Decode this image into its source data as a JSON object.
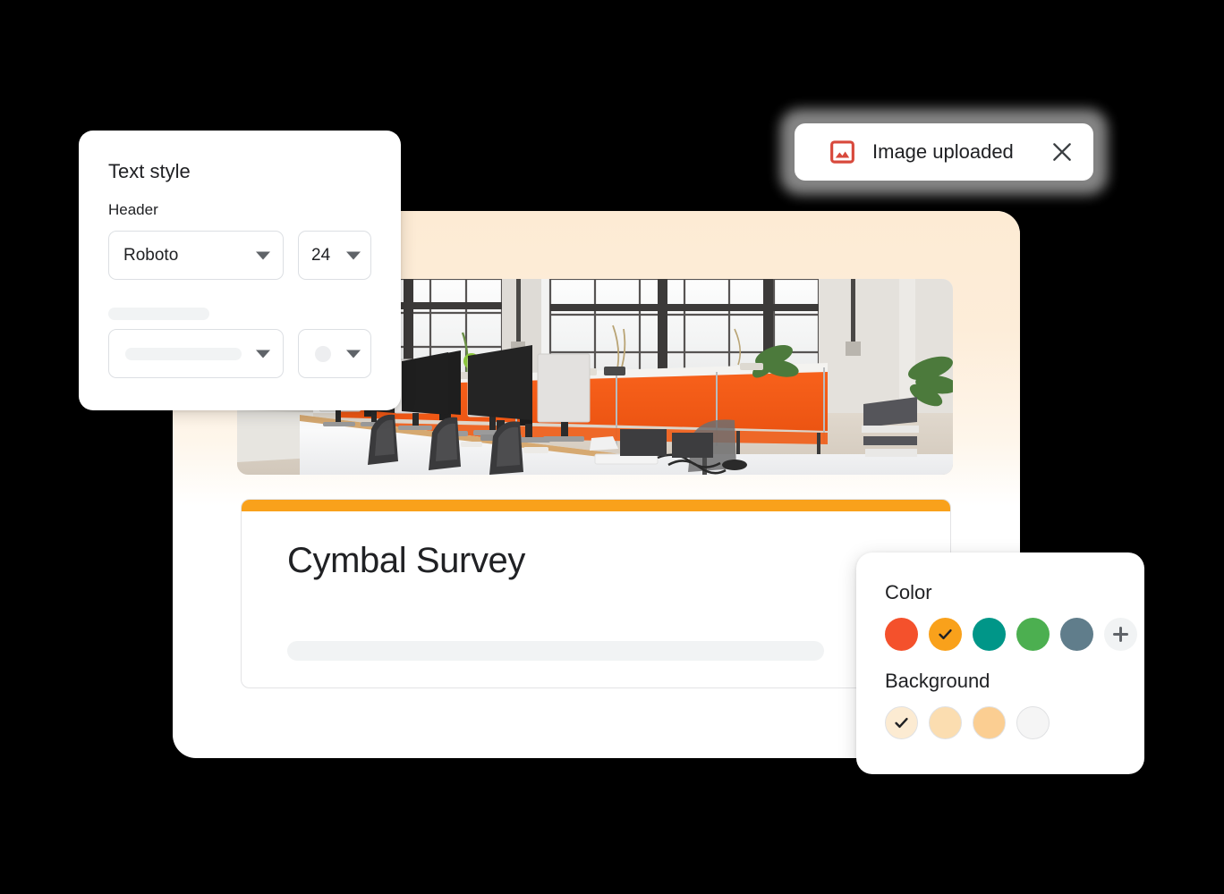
{
  "main_card": {
    "survey": {
      "title": "Cymbal Survey",
      "accent_color": "#F9A11B",
      "placeholder_line": ""
    },
    "hero_image": {
      "alt": "open plan office with monitors and orange cabinet"
    },
    "background_color": "#FDEDD8"
  },
  "text_style_panel": {
    "title": "Text style",
    "subtitle": "Header",
    "font_select": {
      "value": "Roboto",
      "icon": "chevron-down-icon"
    },
    "size_select": {
      "value": "24",
      "icon": "chevron-down-icon"
    },
    "style_select": {
      "value": "",
      "icon": "chevron-down-icon"
    },
    "color_select": {
      "value": "",
      "icon": "chevron-down-icon"
    }
  },
  "toast": {
    "message": "Image uploaded",
    "icon": "image-icon",
    "icon_color": "#D8493C",
    "close_icon": "close-icon"
  },
  "color_panel": {
    "color_label": "Color",
    "background_label": "Background",
    "colors": [
      {
        "name": "red-orange",
        "hex": "#F4512C",
        "selected": false
      },
      {
        "name": "orange",
        "hex": "#F9A11B",
        "selected": true
      },
      {
        "name": "teal",
        "hex": "#009688",
        "selected": false
      },
      {
        "name": "green",
        "hex": "#4CAF50",
        "selected": false
      },
      {
        "name": "slate",
        "hex": "#607D8B",
        "selected": false
      }
    ],
    "add_color": {
      "name": "add-color",
      "icon": "plus-icon"
    },
    "backgrounds": [
      {
        "name": "cream",
        "hex": "#FCEBD2",
        "selected": true
      },
      {
        "name": "light-peach",
        "hex": "#FBDDB0",
        "selected": false
      },
      {
        "name": "peach",
        "hex": "#FBCE92",
        "selected": false
      },
      {
        "name": "white",
        "hex": "#F5F5F5",
        "selected": false
      }
    ]
  }
}
